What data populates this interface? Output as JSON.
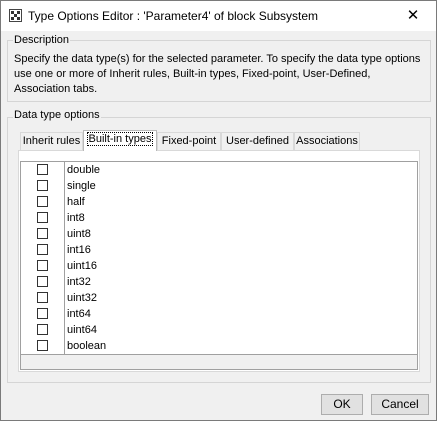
{
  "window": {
    "title": "Type Options Editor : 'Parameter4' of block Subsystem"
  },
  "description": {
    "label": "Description",
    "text": "Specify the data type(s) for the selected parameter. To specify the data type options use one or more of Inherit rules, Built-in types, Fixed-point, User-Defined, Association tabs."
  },
  "options": {
    "label": "Data type options",
    "tabs": [
      "Inherit rules",
      "Built-in types",
      "Fixed-point",
      "User-defined",
      "Associations"
    ],
    "active_tab": "Built-in types",
    "types": [
      "double",
      "single",
      "half",
      "int8",
      "uint8",
      "int16",
      "uint16",
      "int32",
      "uint32",
      "int64",
      "uint64",
      "boolean"
    ],
    "checked": [
      false,
      false,
      false,
      false,
      false,
      false,
      false,
      false,
      false,
      false,
      false,
      false
    ]
  },
  "buttons": {
    "ok": "OK",
    "cancel": "Cancel"
  }
}
